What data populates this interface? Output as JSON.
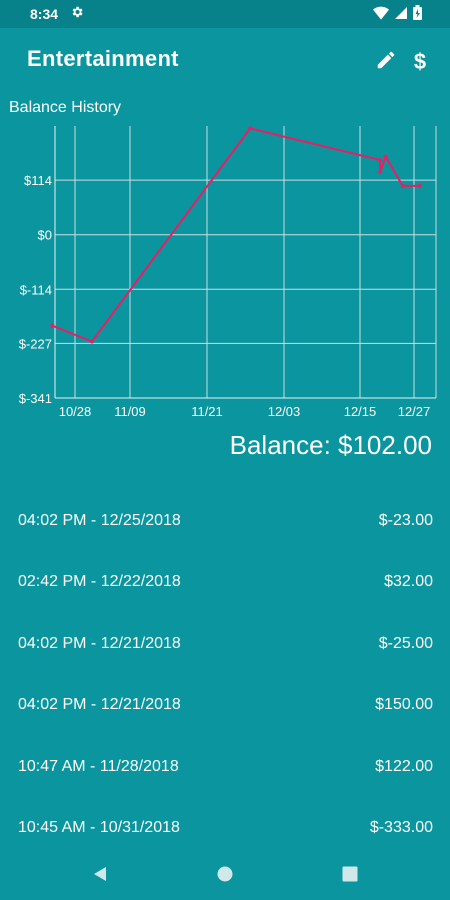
{
  "status": {
    "time": "8:34",
    "icons": [
      "gear-icon",
      "wifi-icon",
      "signal-icon",
      "battery-icon"
    ]
  },
  "app_bar": {
    "title": "Entertainment",
    "edit_icon": "pencil-icon",
    "currency_label": "$"
  },
  "chart_data": {
    "type": "line",
    "title": "Balance History",
    "x_tick_labels": [
      "10/28",
      "11/09",
      "11/21",
      "12/03",
      "12/15",
      "12/27"
    ],
    "y_tick_labels": [
      "$114",
      "$0",
      "$-114",
      "$-227",
      "$-341"
    ],
    "ylim": [
      -341,
      227
    ],
    "x": [
      "10/24/2018",
      "10/31/2018",
      "11/28/2018",
      "12/21/2018",
      "12/21/2018",
      "12/22/2018",
      "12/25/2018",
      "12/28/2018"
    ],
    "values": [
      -190,
      -223,
      222,
      156,
      131,
      163,
      102,
      102
    ],
    "series_color": "#e91e63",
    "grid": true
  },
  "balance_label": "Balance: $102.00",
  "transactions": [
    {
      "datetime": "04:02 PM - 12/25/2018",
      "amount": "$-23.00"
    },
    {
      "datetime": "02:42 PM - 12/22/2018",
      "amount": "$32.00"
    },
    {
      "datetime": "04:02 PM - 12/21/2018",
      "amount": "$-25.00"
    },
    {
      "datetime": "04:02 PM - 12/21/2018",
      "amount": "$150.00"
    },
    {
      "datetime": "10:47 AM - 11/28/2018",
      "amount": "$122.00"
    },
    {
      "datetime": "10:45 AM - 10/31/2018",
      "amount": "$-333.00"
    }
  ]
}
